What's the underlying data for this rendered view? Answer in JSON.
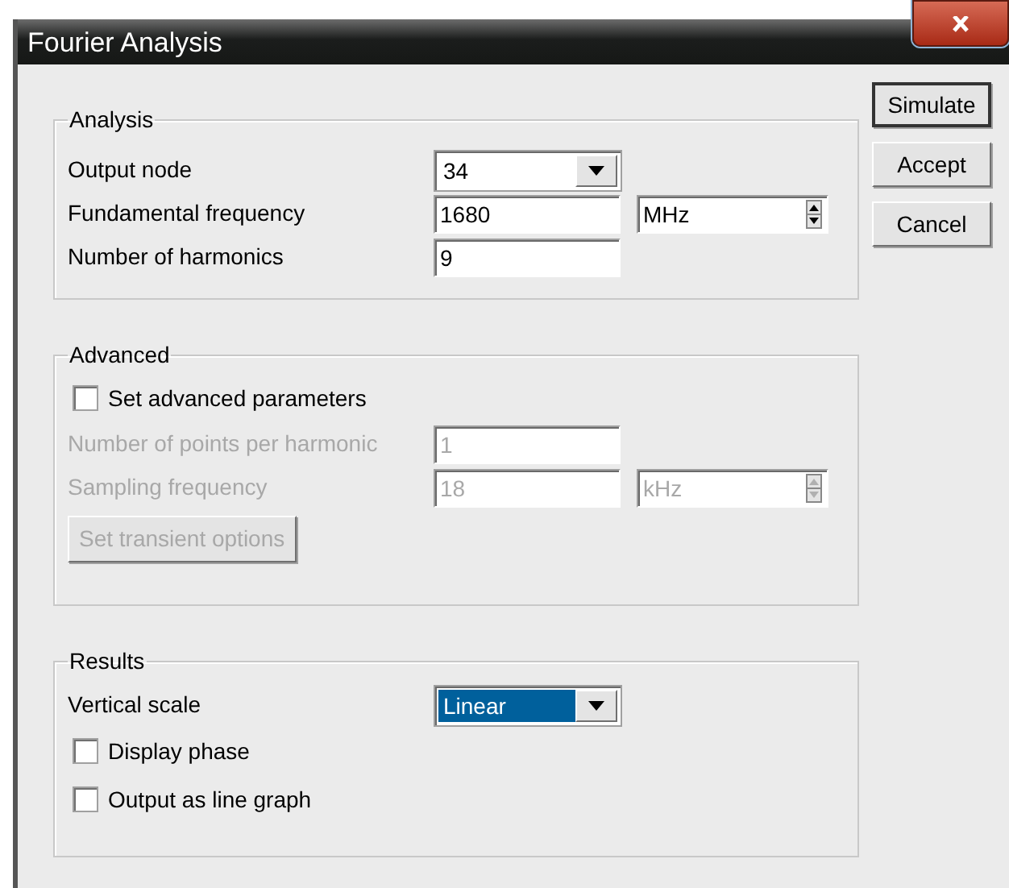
{
  "window": {
    "title": "Fourier Analysis"
  },
  "groups": [
    {
      "title": "Analysis",
      "rows": [
        {
          "kind": "dropdown",
          "label": "Output node",
          "value": "34",
          "highlighted": false,
          "disabled": false
        },
        {
          "kind": "number_unit",
          "label": "Fundamental frequency",
          "value": "1680",
          "unit": "MHz",
          "disabled": false
        },
        {
          "kind": "text",
          "label": "Number of harmonics",
          "value": "9",
          "disabled": false
        }
      ]
    },
    {
      "title": "Advanced",
      "rows": [
        {
          "kind": "checkbox",
          "label": "Set advanced parameters",
          "checked": false,
          "disabled": false
        },
        {
          "kind": "text",
          "label": "Number of points per harmonic",
          "value": "1",
          "disabled": true
        },
        {
          "kind": "number_unit",
          "label": "Sampling frequency",
          "value": "18",
          "unit": "kHz",
          "disabled": true
        },
        {
          "kind": "button",
          "label": "Set transient options",
          "disabled": true
        }
      ]
    },
    {
      "title": "Results",
      "rows": [
        {
          "kind": "dropdown",
          "label": "Vertical scale",
          "value": "Linear",
          "highlighted": true,
          "disabled": false
        },
        {
          "kind": "checkbox",
          "label": "Display phase",
          "checked": false,
          "disabled": false
        },
        {
          "kind": "checkbox",
          "label": "Output as line graph",
          "checked": false,
          "disabled": false
        }
      ]
    }
  ],
  "buttons": [
    {
      "label": "Simulate",
      "focused": true
    },
    {
      "label": "Accept",
      "focused": false
    },
    {
      "label": "Cancel",
      "focused": false
    }
  ]
}
